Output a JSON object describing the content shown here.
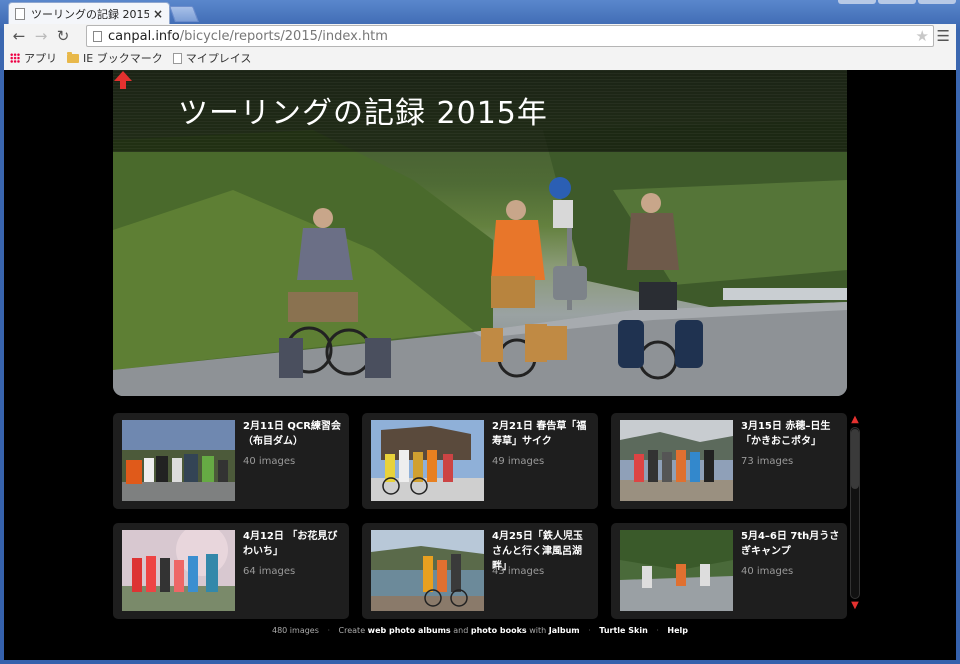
{
  "browser": {
    "tab_title": "ツーリングの記録 2015年",
    "url_host": "canpal.info",
    "url_path": "/bicycle/reports/2015/index.htm",
    "bookmarks": [
      {
        "label": "アプリ",
        "icon": "apps-icon"
      },
      {
        "label": "IE ブックマーク",
        "icon": "folder-icon"
      },
      {
        "label": "マイプレイス",
        "icon": "page-icon"
      }
    ]
  },
  "page": {
    "title": "ツーリングの記録 2015年",
    "albums": [
      {
        "caption": "2月11日 QCR練習会（布目ダム）",
        "count": "40 images"
      },
      {
        "caption": "2月21日 春告草「福寿草」サイク",
        "count": "49 images"
      },
      {
        "caption": "3月15日 赤穂–日生「かきおこポタ」",
        "count": "73 images"
      },
      {
        "caption": "4月12日 「お花見びわいち」",
        "count": "64 images"
      },
      {
        "caption": "4月25日「鉄人児玉さんと行く津風呂湖畔」",
        "count": "43 images"
      },
      {
        "caption": "5月4–6日 7th月うさぎキャンプ",
        "count": "40 images"
      }
    ],
    "footer": {
      "count": "480 images",
      "create": "Create",
      "web_albums": "web photo albums",
      "and": "and",
      "photo_books": "photo books",
      "with": "with",
      "jalbum": "Jalbum",
      "skin": "Turtle Skin",
      "help": "Help"
    }
  },
  "colors": {
    "accent": "#e4312f",
    "card_bg": "#1e1e1e",
    "page_bg": "#000000"
  }
}
